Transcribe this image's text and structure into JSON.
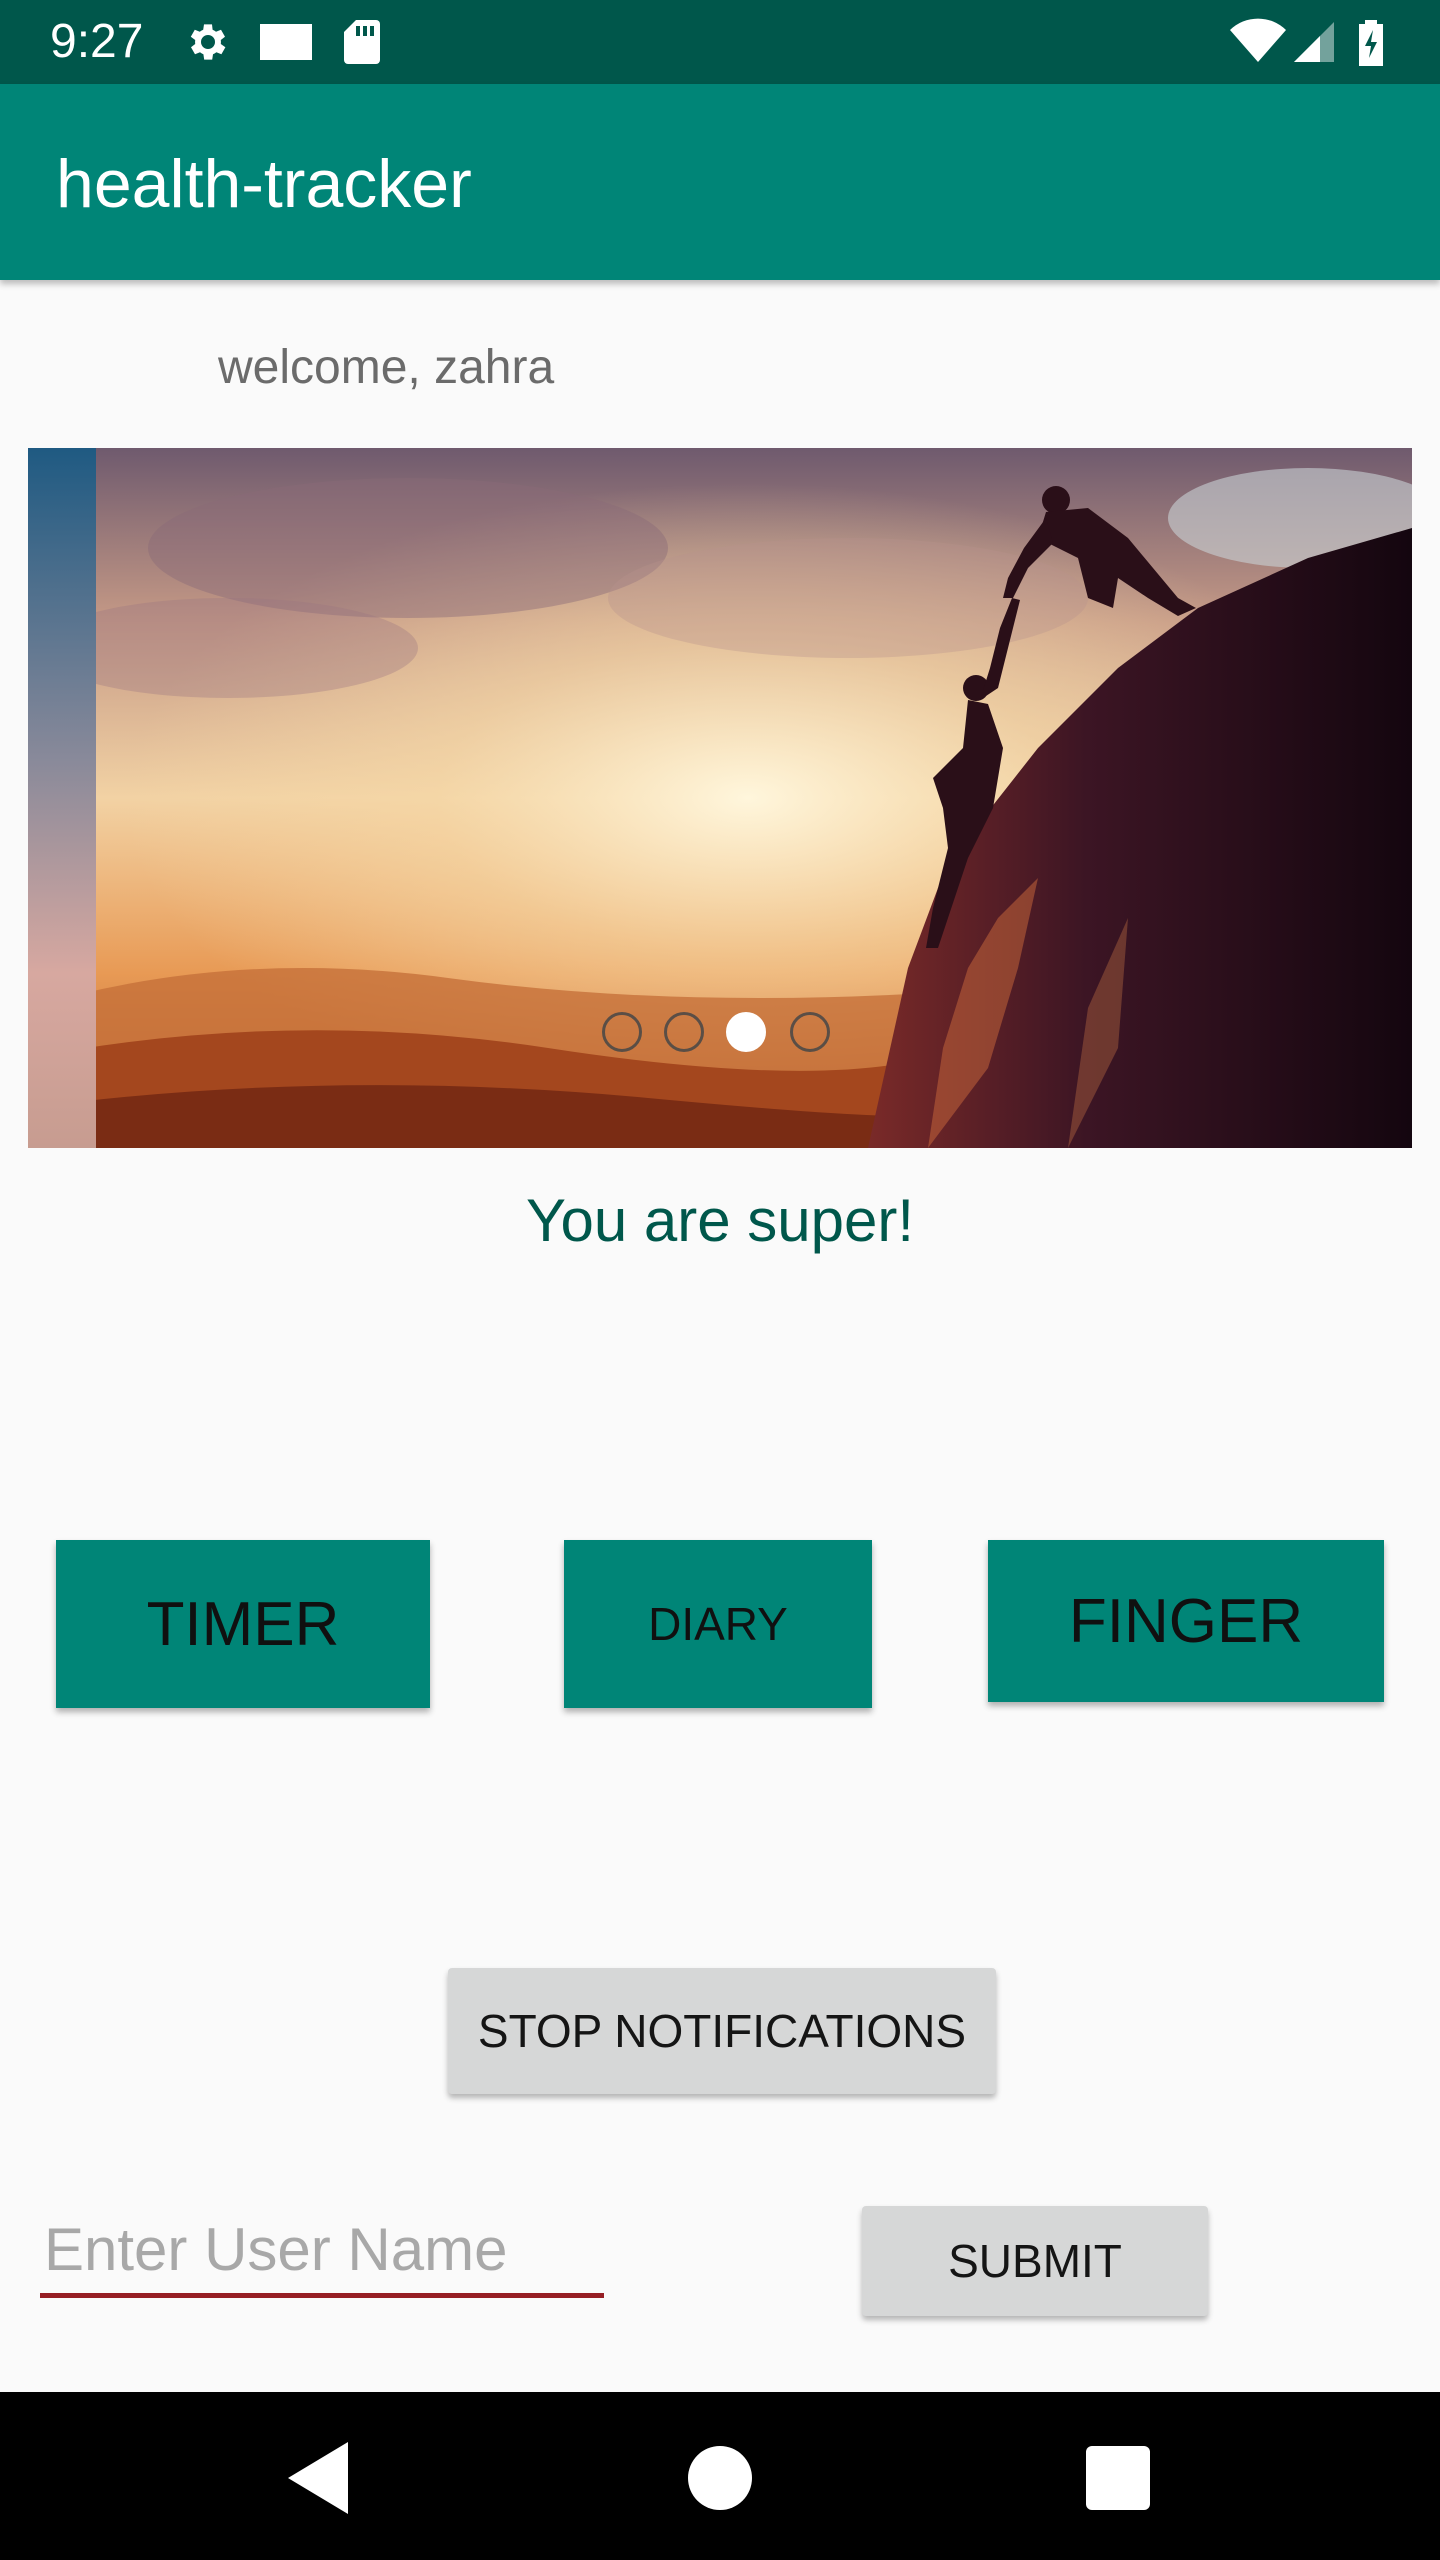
{
  "status_bar": {
    "time": "9:27",
    "icons": [
      "gear-icon",
      "message-icon",
      "sd-card-icon",
      "wifi-icon",
      "signal-icon",
      "battery-charging-icon"
    ]
  },
  "app_bar": {
    "title": "health-tracker",
    "color": "#008577"
  },
  "welcome_text": "welcome, zahra",
  "carousel": {
    "active_index": 2,
    "dot_count": 4
  },
  "motivation_text": "You are super!",
  "buttons": {
    "timer": "TIMER",
    "diary": "DIARY",
    "finger": "FINGER",
    "stop_notifications": "STOP NOTIFICATIONS",
    "submit": "SUBMIT"
  },
  "username_input": {
    "placeholder": "Enter User Name",
    "value": ""
  },
  "nav_bar": {
    "icons": [
      "back-icon",
      "home-icon",
      "recents-icon"
    ]
  },
  "colors": {
    "primary": "#008577",
    "primary_dark": "#00574b",
    "accent": "#961e24",
    "background": "#fafafa"
  }
}
